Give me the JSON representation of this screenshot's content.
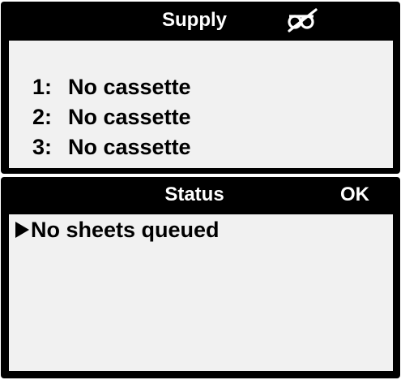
{
  "supply": {
    "title": "Supply",
    "status_icon": "no-cassette-icon",
    "slots": [
      {
        "number": "1:",
        "state": "No cassette"
      },
      {
        "number": "2:",
        "state": "No cassette"
      },
      {
        "number": "3:",
        "state": "No cassette"
      }
    ]
  },
  "status": {
    "title": "Status",
    "state": "OK",
    "queue_pointer_icon": "triangle-pointer-icon",
    "message": "No sheets queued"
  },
  "colors": {
    "frame": "#000000",
    "header_text": "#ffffff",
    "body_background": "#f1f1f1",
    "body_text": "#000000"
  }
}
